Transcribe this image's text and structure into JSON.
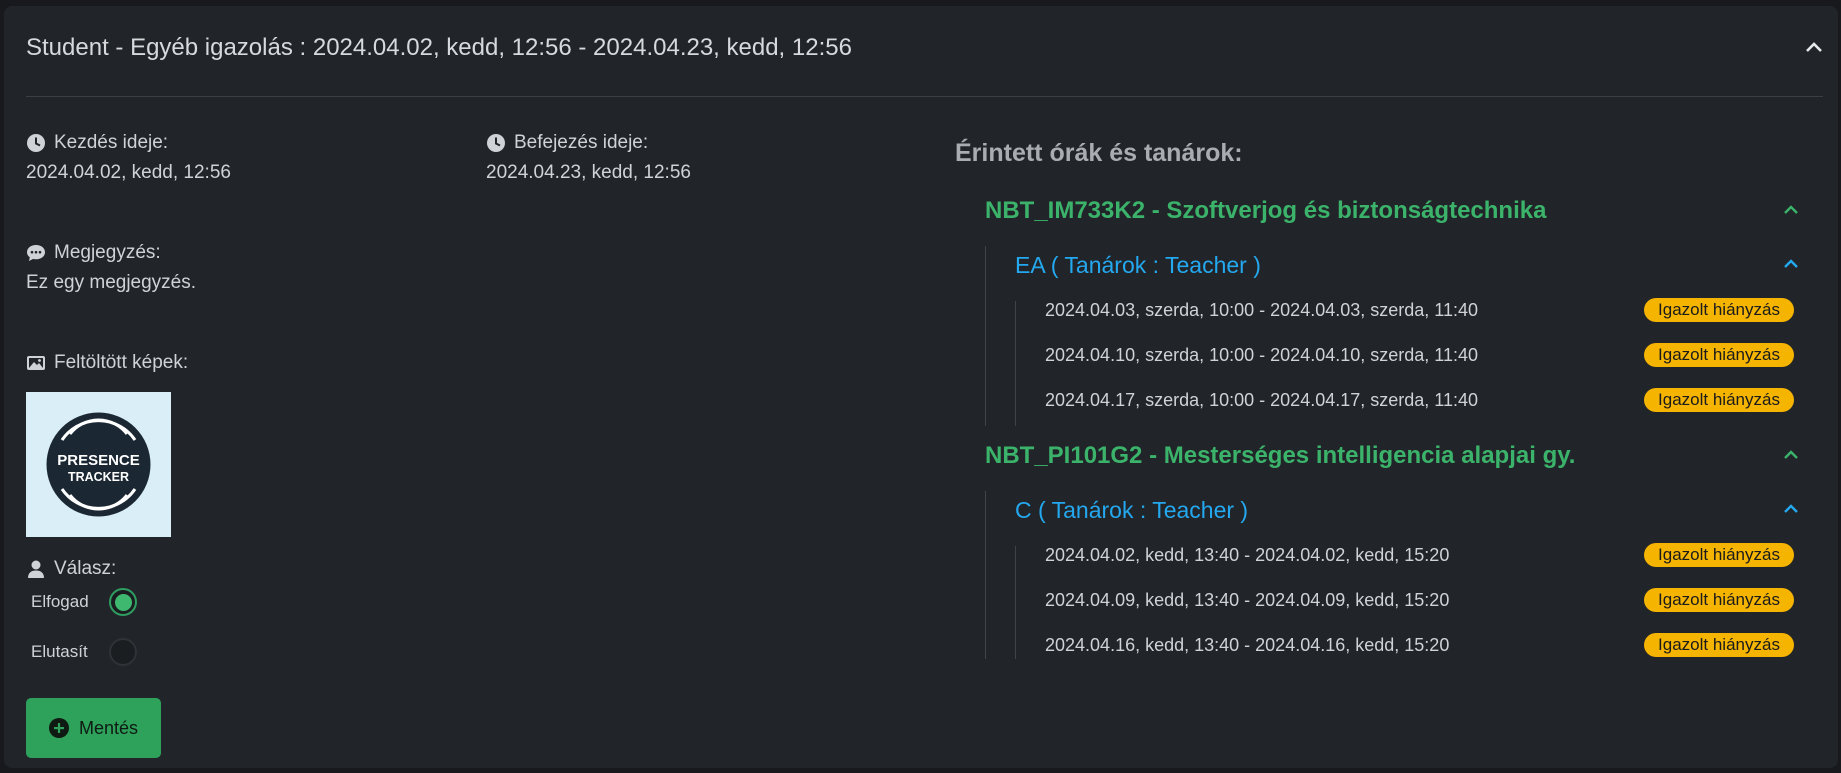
{
  "header": {
    "title": "Student - Egyéb igazolás : 2024.04.02, kedd, 12:56 - 2024.04.23, kedd, 12:56"
  },
  "start": {
    "label": "Kezdés ideje:",
    "value": "2024.04.02, kedd, 12:56"
  },
  "end": {
    "label": "Befejezés ideje:",
    "value": "2024.04.23, kedd, 12:56"
  },
  "note": {
    "label": "Megjegyzés:",
    "value": "Ez egy megjegyzés."
  },
  "images": {
    "label": "Feltöltött képek:",
    "logo_line1": "PRESENCE",
    "logo_line2": "TRACKER"
  },
  "response": {
    "label": "Válasz:",
    "accept": "Elfogad",
    "reject": "Elutasít",
    "selected": "accept"
  },
  "save_label": "Mentés",
  "affected": {
    "title": "Érintett órák és tanárok:",
    "subjects": [
      {
        "name": "NBT_IM733K2 - Szoftverjog és biztonságtechnika",
        "group": "EA ( Tanárok : Teacher )",
        "sessions": [
          {
            "time": "2024.04.03, szerda, 10:00 - 2024.04.03, szerda, 11:40",
            "status": "Igazolt hiányzás"
          },
          {
            "time": "2024.04.10, szerda, 10:00 - 2024.04.10, szerda, 11:40",
            "status": "Igazolt hiányzás"
          },
          {
            "time": "2024.04.17, szerda, 10:00 - 2024.04.17, szerda, 11:40",
            "status": "Igazolt hiányzás"
          }
        ]
      },
      {
        "name": "NBT_PI101G2 - Mesterséges intelligencia alapjai gy.",
        "group": "C ( Tanárok : Teacher )",
        "sessions": [
          {
            "time": "2024.04.02, kedd, 13:40 - 2024.04.02, kedd, 15:20",
            "status": "Igazolt hiányzás"
          },
          {
            "time": "2024.04.09, kedd, 13:40 - 2024.04.09, kedd, 15:20",
            "status": "Igazolt hiányzás"
          },
          {
            "time": "2024.04.16, kedd, 13:40 - 2024.04.16, kedd, 15:20",
            "status": "Igazolt hiányzás"
          }
        ]
      }
    ]
  },
  "colors": {
    "subject": "#3bb36a",
    "group": "#24a8ef",
    "badge": "#f5b400",
    "save_button": "#2ea15b"
  }
}
